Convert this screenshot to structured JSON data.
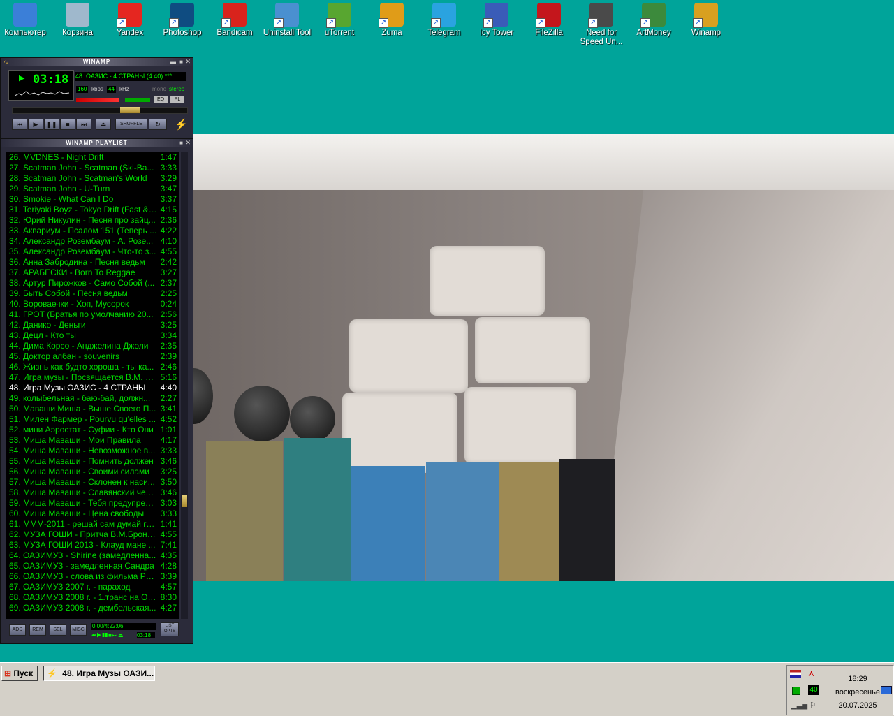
{
  "desktop": {
    "icons": [
      {
        "label": "Компьютер",
        "icon": "computer-icon",
        "color": "#3b7fd8"
      },
      {
        "label": "Корзина",
        "icon": "recycle-bin-icon",
        "color": "#9fb8cc"
      },
      {
        "label": "Yandex",
        "icon": "yandex-browser-icon",
        "color": "#e52620"
      },
      {
        "label": "Photoshop",
        "icon": "photoshop-icon",
        "color": "#0f4c81"
      },
      {
        "label": "Bandicam",
        "icon": "bandicam-icon",
        "color": "#d8231c"
      },
      {
        "label": "Uninstall Tool",
        "icon": "uninstall-tool-icon",
        "color": "#4a90d0"
      },
      {
        "label": "uTorrent",
        "icon": "utorrent-icon",
        "color": "#58a630"
      },
      {
        "label": "Zuma",
        "icon": "zuma-icon",
        "color": "#e09c18"
      },
      {
        "label": "Telegram",
        "icon": "telegram-icon",
        "color": "#2aa3e0"
      },
      {
        "label": "Icy Tower",
        "icon": "icy-tower-icon",
        "color": "#3a5cb8"
      },
      {
        "label": "FileZilla",
        "icon": "filezilla-icon",
        "color": "#c4161c"
      },
      {
        "label": "Need for Speed Un...",
        "icon": "need-for-speed-icon",
        "color": "#4a4a4a"
      },
      {
        "label": "ArtMoney",
        "icon": "artmoney-icon",
        "color": "#3c8a3c"
      },
      {
        "label": "Winamp",
        "icon": "winamp-icon",
        "color": "#d8a020"
      }
    ]
  },
  "winamp": {
    "title": "WINAMP",
    "time": "03:18",
    "marquee": "48. ОАЗИС - 4 СТРАНЫ (4:40) ***",
    "kbps": "160",
    "kbps_label": "kbps",
    "khz": "44",
    "khz_label": "kHz",
    "mono": "mono",
    "stereo": "stereo",
    "eq": "EQ",
    "pl": "PL",
    "shuffle": "SHUFFLE",
    "progress": 0.7
  },
  "playlist": {
    "title": "WINAMP PLAYLIST",
    "current_index": 22,
    "items": [
      {
        "t": "26. MVDNES - Night Drift",
        "d": "1:47"
      },
      {
        "t": "27. Scatman John - Scatman (Ski-Ba...",
        "d": "3:33"
      },
      {
        "t": "28. Scatman John - Scatman's World",
        "d": "3:29"
      },
      {
        "t": "29. Scatman John - U-Turn",
        "d": "3:47"
      },
      {
        "t": "30. Smokie - What Can I Do",
        "d": "3:37"
      },
      {
        "t": "31. Teriyaki Boyz - Tokyo Drift (Fast & ...",
        "d": "4:15"
      },
      {
        "t": "32. Юрий Никулин - Песня про зайц...",
        "d": "2:36"
      },
      {
        "t": "33. Аквариум - Псалом 151 (Теперь ...",
        "d": "4:22"
      },
      {
        "t": "34. Александр Розембаум - А. Розе...",
        "d": "4:10"
      },
      {
        "t": "35. Александр Розембаум - Что-то з...",
        "d": "4:55"
      },
      {
        "t": "36. Анна Забродина - Песня ведьм",
        "d": "2:42"
      },
      {
        "t": "37. АРАБЕСКИ - Born To Reggae",
        "d": "3:27"
      },
      {
        "t": "38. Артур Пирожков - Само Собой (...",
        "d": "2:37"
      },
      {
        "t": "39. Быть Собой - Песня ведьм",
        "d": "2:25"
      },
      {
        "t": "40. Вороваечки - Хоп, Мусорок",
        "d": "0:24"
      },
      {
        "t": "41. ГРОТ (Братья по умолчанию 20...",
        "d": "2:56"
      },
      {
        "t": "42. Данико - Деньги",
        "d": "3:25"
      },
      {
        "t": "43. Децл - Кто ты",
        "d": "3:34"
      },
      {
        "t": "44. Дима Корсо - Анджелина Джоли",
        "d": "2:35"
      },
      {
        "t": "45. Доктор албан - souvenirs",
        "d": "2:39"
      },
      {
        "t": "46. Жизнь как будто хороша - ты ка...",
        "d": "2:46"
      },
      {
        "t": "47. Игра музы - Посвящается В.М. Б...",
        "d": "5:16"
      },
      {
        "t": "48. Игра Музы ОАЗИС - 4 СТРАНЫ",
        "d": "4:40"
      },
      {
        "t": "49. колыбельная - баю-бай, должн...",
        "d": "2:27"
      },
      {
        "t": "50. Маваши Миша - Выше Своего П...",
        "d": "3:41"
      },
      {
        "t": "51. Милен Фармер - Pourvu qu'elles ...",
        "d": "4:52"
      },
      {
        "t": "52. мини Аэростат - Суфии - Кто Они",
        "d": "1:01"
      },
      {
        "t": "53. Миша Маваши - Мои Правила",
        "d": "4:17"
      },
      {
        "t": "54. Миша Маваши - Невозможное в...",
        "d": "3:33"
      },
      {
        "t": "55. Миша Маваши - Помнить должен",
        "d": "3:46"
      },
      {
        "t": "56. Миша Маваши - Своими силами",
        "d": "3:25"
      },
      {
        "t": "57. Миша Маваши - Склонен к наси...",
        "d": "3:50"
      },
      {
        "t": "58. Миша Маваши - Славянский чел...",
        "d": "3:46"
      },
      {
        "t": "59. Миша Маваши - Тебя предупреж...",
        "d": "3:03"
      },
      {
        "t": "60. Миша Маваши - Цена свободы",
        "d": "3:33"
      },
      {
        "t": "61. МММ-2011 - решай сам думай го...",
        "d": "1:41"
      },
      {
        "t": "62. МУЗА ГОШИ - Притча В.М.Бронн...",
        "d": "4:55"
      },
      {
        "t": "63. МУЗА ГОШИ 2013 - Клауд мане ...",
        "d": "7:41"
      },
      {
        "t": "64. ОАЗИМУЗ - Shirine (замедленна...",
        "d": "4:35"
      },
      {
        "t": "65. ОАЗИМУЗ - замедленная Сандра",
        "d": "4:28"
      },
      {
        "t": "66. ОАЗИМУЗ - слова из фильма РЕ...",
        "d": "3:39"
      },
      {
        "t": "67. ОАЗИМУЗ 2007 г. - параход",
        "d": "4:57"
      },
      {
        "t": "68. ОАЗИМУЗ 2008 г. - 1.транс на Ол...",
        "d": "8:30"
      },
      {
        "t": "69. ОАЗИМУЗ 2008 г. - дембельская...",
        "d": "4:27"
      }
    ],
    "btn_add": "ADD",
    "btn_rem": "REM",
    "btn_sel": "SEL",
    "btn_misc": "MISC",
    "btn_list": "LIST OPTS",
    "total_time": "0:00/4:22:06",
    "mini_time": "03:18"
  },
  "taskbar": {
    "start_label": "Пуск",
    "task_label": "48. Игра Музы ОАЗИ...",
    "clock": "18:29",
    "day": "воскресенье",
    "date": "20.07.2025",
    "tray_badge": "40"
  }
}
